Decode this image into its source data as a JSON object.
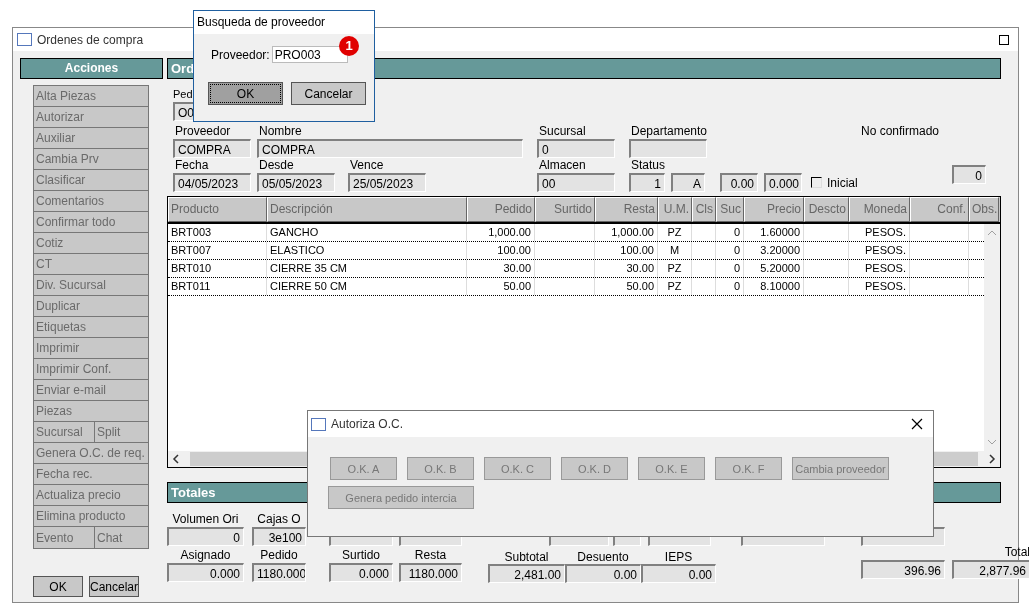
{
  "main_window": {
    "title": "Ordenes de compra"
  },
  "sidebar": {
    "title": "Acciones",
    "rows": [
      [
        "Alta Piezas"
      ],
      [
        "Autorizar"
      ],
      [
        "Auxiliar"
      ],
      [
        "Cambia Prv"
      ],
      [
        "Clasificar"
      ],
      [
        "Comentarios"
      ],
      [
        "Confirmar todo"
      ],
      [
        "Cotiz"
      ],
      [
        "CT"
      ],
      [
        "Div. Sucursal"
      ],
      [
        "Duplicar"
      ],
      [
        "Etiquetas"
      ],
      [
        "Imprimir"
      ],
      [
        "Imprimir Conf."
      ],
      [
        "Enviar e-mail"
      ],
      [
        "Piezas"
      ],
      [
        "Sucursal",
        "Split"
      ],
      [
        "Genera O.C. de req."
      ],
      [
        "Fecha rec."
      ],
      [
        "Actualiza precio"
      ],
      [
        "Elimina producto"
      ],
      [
        "Evento",
        "Chat"
      ]
    ],
    "buttons": [
      "OK",
      "Cancelar"
    ]
  },
  "header": {
    "title": "Ord"
  },
  "form": {
    "pedido": {
      "label": "Ped",
      "value": "O0"
    },
    "proveedor": {
      "label": "Proveedor",
      "value": "COMPRA"
    },
    "nombre": {
      "label": "Nombre",
      "value": "COMPRA"
    },
    "sucursal": {
      "label": "Sucursal",
      "value": "0"
    },
    "departamento": {
      "label": "Departamento"
    },
    "state_text": "No confirmado",
    "fecha": {
      "label": "Fecha",
      "value": "04/05/2023"
    },
    "desde": {
      "label": "Desde",
      "value": "05/05/2023"
    },
    "vence": {
      "label": "Vence",
      "value": "25/05/2023"
    },
    "almacen": {
      "label": "Almacen",
      "value": "00"
    },
    "status": {
      "label": "Status",
      "values": [
        "1",
        "A"
      ]
    },
    "amounts": [
      "0.00",
      "0.000"
    ],
    "inicial": {
      "label": "Inicial",
      "checked": false
    },
    "counter": "0"
  },
  "table": {
    "columns": [
      "Producto",
      "Descripción",
      "Pedido",
      "Surtido",
      "Resta",
      "U.M.",
      "Cls",
      "Suc",
      "Precio",
      "Descto",
      "Moneda",
      "Conf.",
      "Obs."
    ],
    "rows": [
      [
        "BRT003",
        "GANCHO",
        "1,000.00",
        "",
        "1,000.00",
        "PZ",
        "",
        "0",
        "1.60000",
        "",
        "PESOS.",
        "",
        ""
      ],
      [
        "BRT007",
        "ELASTICO",
        "100.00",
        "",
        "100.00",
        "M",
        "",
        "0",
        "3.20000",
        "",
        "PESOS.",
        "",
        ""
      ],
      [
        "BRT010",
        "CIERRE 35 CM",
        "30.00",
        "",
        "30.00",
        "PZ",
        "",
        "0",
        "5.20000",
        "",
        "PESOS.",
        "",
        ""
      ],
      [
        "BRT011",
        "CIERRE 50 CM",
        "50.00",
        "",
        "50.00",
        "PZ",
        "",
        "0",
        "8.10000",
        "",
        "PESOS.",
        "",
        ""
      ]
    ]
  },
  "totals": {
    "title": "Totales",
    "columns": [
      {
        "label": "Volumen Ori",
        "value": "0",
        "label_2": "Asignado",
        "value_2": "0.000"
      },
      {
        "label": "Cajas O",
        "value": "3e100",
        "label_2": "Pedido",
        "value_2": "1180.000"
      },
      {
        "label_2": "Surtido",
        "value_2": "0.000"
      },
      {
        "label_2": "Resta",
        "value_2": "1180.000"
      }
    ],
    "charges": [
      {
        "label": "Subtotal",
        "value": "2,481.00"
      },
      {
        "label": "Desuento",
        "value": "0.00"
      },
      {
        "label": "IEPS",
        "value": "0.00"
      }
    ],
    "tax": "396.96",
    "total": {
      "label": "Total",
      "value": "2,877.96"
    }
  },
  "search_dialog": {
    "title": "Busqueda de proveedor",
    "field_label": "Proveedor:",
    "value": "PRO003",
    "badge": "1",
    "buttons": [
      {
        "label": "OK",
        "selected": true
      },
      {
        "label": "Cancelar",
        "selected": false
      }
    ]
  },
  "authorize_dialog": {
    "title": "Autoriza O.C.",
    "buttons": [
      {
        "label": "O.K. A",
        "disabled": true
      },
      {
        "label": "O.K. B",
        "disabled": true
      },
      {
        "label": "O.K. C",
        "disabled": true
      },
      {
        "label": "O.K. D",
        "disabled": true
      },
      {
        "label": "O.K. E",
        "disabled": true
      },
      {
        "label": "O.K. F",
        "disabled": true
      },
      {
        "label": "Cambia proveedor",
        "disabled": true
      },
      {
        "label": "Genera pedido intercia",
        "disabled": true
      }
    ]
  }
}
